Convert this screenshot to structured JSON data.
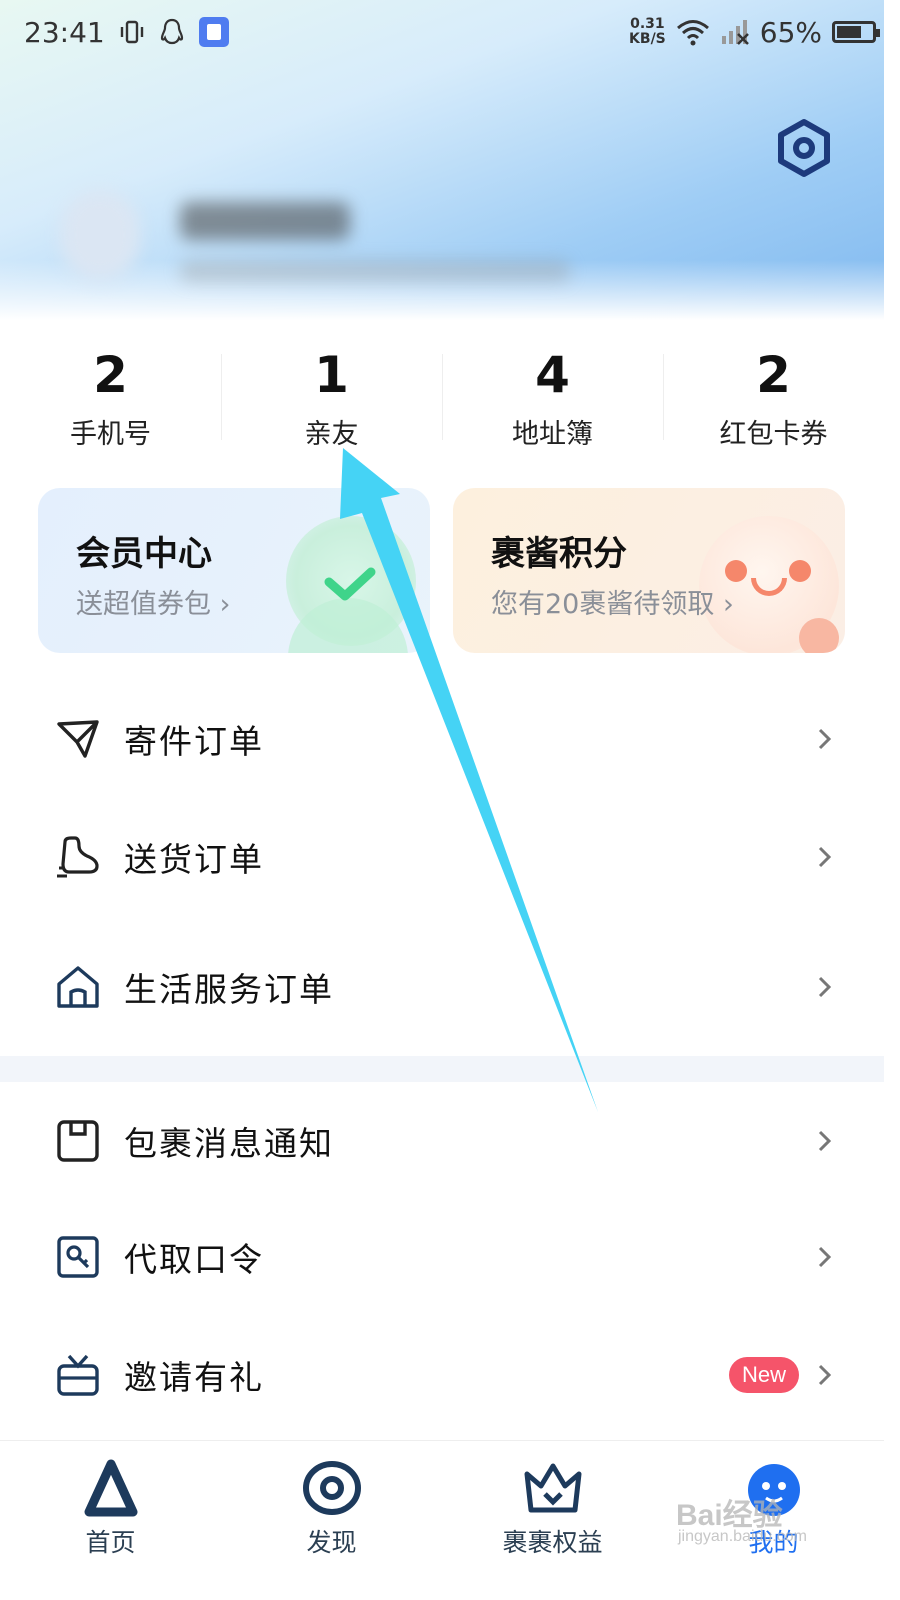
{
  "status_bar": {
    "time": "23:41",
    "net_speed_value": "0.31",
    "net_speed_unit": "KB/S",
    "battery": "65%"
  },
  "stats": [
    {
      "value": "2",
      "label": "手机号"
    },
    {
      "value": "1",
      "label": "亲友"
    },
    {
      "value": "4",
      "label": "地址簿"
    },
    {
      "value": "2",
      "label": "红包卡券"
    }
  ],
  "cards": {
    "member": {
      "title": "会员中心",
      "subtitle": "送超值券包 ›"
    },
    "points": {
      "title": "裹酱积分",
      "subtitle": "您有20裹酱待领取 ›"
    }
  },
  "menu": [
    {
      "label": "寄件订单",
      "icon": "paper-plane-icon"
    },
    {
      "label": "送货订单",
      "icon": "delivery-icon"
    },
    {
      "label": "生活服务订单",
      "icon": "home-icon"
    },
    {
      "label": "包裹消息通知",
      "icon": "package-message-icon"
    },
    {
      "label": "代取口令",
      "icon": "key-card-icon"
    },
    {
      "label": "邀请有礼",
      "icon": "gift-tv-icon",
      "badge": "New"
    }
  ],
  "bottom_nav": [
    {
      "label": "首页",
      "icon": "home-logo-icon",
      "active": false
    },
    {
      "label": "发现",
      "icon": "discover-icon",
      "active": false
    },
    {
      "label": "裹裹权益",
      "icon": "crown-icon",
      "active": false
    },
    {
      "label": "我的",
      "icon": "profile-avatar-icon",
      "active": true
    }
  ],
  "watermark": {
    "text": "Bai经验",
    "sub": "jingyan.baidu.com"
  },
  "colors": {
    "accent_blue": "#1f6ff0",
    "dark_navy": "#1d3a5c",
    "arrow_cyan": "#45d3f5",
    "new_badge": "#f5546a"
  }
}
